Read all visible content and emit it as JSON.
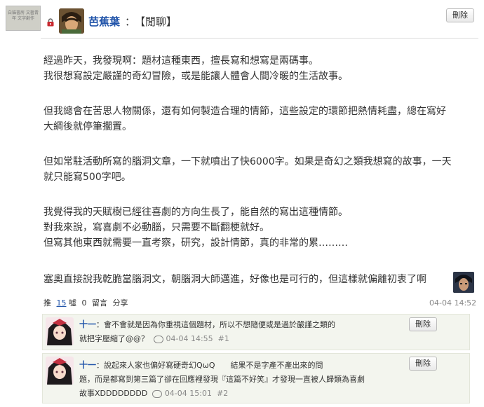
{
  "header": {
    "blog_badge_text": "白貓書房 文藝青年 文字創作",
    "author": "芭蕉葉",
    "colon": "：",
    "title": "【閒聊】",
    "delete_label": "刪除"
  },
  "post": {
    "paragraphs": [
      [
        "經過昨天，我發現啊：題材這種東西，擅長寫和想寫是兩碼事。",
        "我很想寫設定嚴謹的奇幻冒險，或是能讓人體會人間冷暖的生活故事。"
      ],
      [
        "但我總會在苦思人物關係，還有如何製造合理的情節，這些設定的環節把熱情耗盡，總在寫好",
        "大綱後就停筆擱置。"
      ],
      [
        "但如常駐活動所寫的腦洞文章，一下就噴出了快6000字。如果是奇幻之類我想寫的故事，一天",
        "就只能寫500字吧。"
      ],
      [
        "我覺得我的天賦樹已經往喜劇的方向生長了，能自然的寫出這種情節。",
        "對我來說，寫喜劇不必動腦，只需要不斷翻梗就好。",
        "但寫其他東西就需要一直考察，研究，設計情節，真的非常的累………"
      ],
      [
        "塞奧直接說我乾脆當腦洞文，朝腦洞大師邁進，好像也是可行的，但這樣就偏離初衷了啊"
      ]
    ]
  },
  "actions": {
    "push_label": "推",
    "push_count": "15",
    "boo_label": "噓",
    "boo_count": "0",
    "comment_label": "留言",
    "share_label": "分享",
    "timestamp": "04-04 14:52"
  },
  "comments": [
    {
      "name": "十一",
      "lines": [
        "：會不會就是因為你重視這個題材，所以不想隨便或是過於嚴謹之類的",
        "就把字壓縮了@@？"
      ],
      "timestamp": "04-04 14:55",
      "floor": "#1",
      "delete_label": "刪除"
    },
    {
      "name": "十一",
      "lines": [
        "：說起來人家也偏好寫硬奇幻QωQ　　結果不是字產不產出來的問",
        "題，而是都寫到第三篇了卻在回應裡發現『這篇不好笑』才發現一直被人歸類為喜劇",
        "故事XDDDDDDDD"
      ],
      "timestamp": "04-04 15:01",
      "floor": "#2",
      "delete_label": "刪除"
    }
  ],
  "colors": {
    "link": "#2255aa",
    "meta": "#888888",
    "comment_bg": "#f3f5ee"
  }
}
